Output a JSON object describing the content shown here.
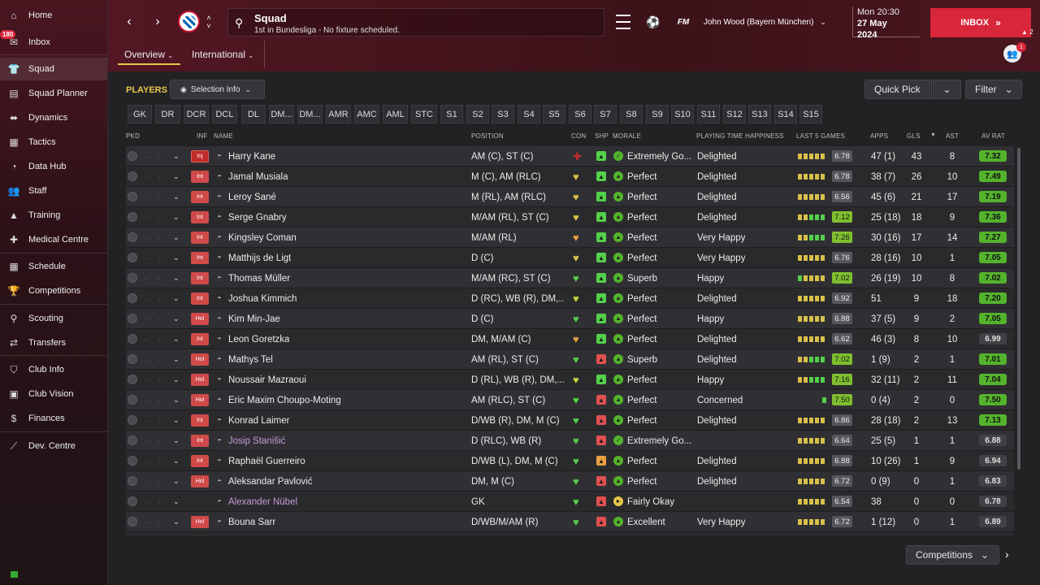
{
  "sidebar": {
    "items": [
      {
        "label": "Home",
        "icon": "home-icon",
        "glyph": "⌂"
      },
      {
        "label": "Inbox",
        "icon": "inbox-icon",
        "glyph": "✉"
      },
      {
        "label": "Squad",
        "icon": "squad-icon",
        "glyph": "👕"
      },
      {
        "label": "Squad Planner",
        "icon": "squad-planner-icon",
        "glyph": "▤"
      },
      {
        "label": "Dynamics",
        "icon": "dynamics-icon",
        "glyph": "⬌"
      },
      {
        "label": "Tactics",
        "icon": "tactics-icon",
        "glyph": "▦"
      },
      {
        "label": "Data Hub",
        "icon": "data-hub-icon",
        "glyph": "◔"
      },
      {
        "label": "Staff",
        "icon": "staff-icon",
        "glyph": "👥"
      },
      {
        "label": "Training",
        "icon": "training-icon",
        "glyph": "▲"
      },
      {
        "label": "Medical Centre",
        "icon": "medical-centre-icon",
        "glyph": "✚"
      },
      {
        "label": "Schedule",
        "icon": "schedule-icon",
        "glyph": "▦"
      },
      {
        "label": "Competitions",
        "icon": "competitions-icon",
        "glyph": "🏆"
      },
      {
        "label": "Scouting",
        "icon": "scouting-icon",
        "glyph": "⚲"
      },
      {
        "label": "Transfers",
        "icon": "transfers-icon",
        "glyph": "⇄"
      },
      {
        "label": "Club Info",
        "icon": "club-info-icon",
        "glyph": "⛉"
      },
      {
        "label": "Club Vision",
        "icon": "club-vision-icon",
        "glyph": "▣"
      },
      {
        "label": "Finances",
        "icon": "finances-icon",
        "glyph": "$"
      },
      {
        "label": "Dev. Centre",
        "icon": "dev-centre-icon",
        "glyph": "⟋"
      }
    ],
    "inbox_badge": "180"
  },
  "header": {
    "title": "Squad",
    "subtitle": "1st in Bundesliga - No fixture scheduled.",
    "manager": "John Wood (Bayern München)",
    "fm": "FM",
    "time": "Mon 20:30",
    "date_line1": "27 May",
    "date_line2": "2024",
    "inbox_label": "INBOX",
    "inbox_count": "2",
    "notif_count": "1"
  },
  "tabs": {
    "overview": "Overview",
    "international": "International"
  },
  "toolbar": {
    "players_label": "PLAYERS",
    "selection_info": "Selection Info",
    "quick_pick": "Quick Pick",
    "filter": "Filter",
    "competitions": "Competitions"
  },
  "positions": [
    "GK",
    "DR",
    "DCR",
    "DCL",
    "DL",
    "DM...",
    "DM...",
    "AMR",
    "AMC",
    "AML",
    "STC",
    "S1",
    "S2",
    "S3",
    "S4",
    "S5",
    "S6",
    "S7",
    "S8",
    "S9",
    "S10",
    "S11",
    "S12",
    "S13",
    "S14",
    "S15"
  ],
  "columns": {
    "pkd": "PKD",
    "inf": "INF",
    "name": "NAME",
    "position": "POSITION",
    "con": "CON",
    "shp": "SHP",
    "morale": "MORALE",
    "pth": "PLAYING TIME HAPPINESS",
    "last5": "LAST 5 GAMES",
    "apps": "APPS",
    "gls": "GLS",
    "ast": "AST",
    "avrat": "AV RAT"
  },
  "colors": {
    "accent": "#d8263a",
    "good": "#54b32c",
    "header": "#521723"
  },
  "players": [
    {
      "inf": "Inj",
      "name": "Harry Kane",
      "position": "AM (C), ST (C)",
      "morale": "Extremely Go...",
      "pth": "Delighted",
      "l5": "6.78",
      "apps": "47 (1)",
      "gls": "43",
      "ast": "8",
      "avrat": "7.32"
    },
    {
      "inf": "Int",
      "name": "Jamal Musiala",
      "position": "M (C), AM (RLC)",
      "morale": "Perfect",
      "pth": "Delighted",
      "l5": "6.78",
      "apps": "38 (7)",
      "gls": "26",
      "ast": "10",
      "avrat": "7.49"
    },
    {
      "inf": "Int",
      "name": "Leroy Sané",
      "position": "M (RL), AM (RLC)",
      "morale": "Perfect",
      "pth": "Delighted",
      "l5": "6.56",
      "apps": "45 (6)",
      "gls": "21",
      "ast": "17",
      "avrat": "7.19"
    },
    {
      "inf": "Int",
      "name": "Serge Gnabry",
      "position": "M/AM (RL), ST (C)",
      "morale": "Perfect",
      "pth": "Delighted",
      "l5": "7.12",
      "apps": "25 (18)",
      "gls": "18",
      "ast": "9",
      "avrat": "7.36"
    },
    {
      "inf": "Int",
      "name": "Kingsley Coman",
      "position": "M/AM (RL)",
      "morale": "Perfect",
      "pth": "Very Happy",
      "l5": "7.26",
      "apps": "30 (16)",
      "gls": "17",
      "ast": "14",
      "avrat": "7.27"
    },
    {
      "inf": "Int",
      "name": "Matthijs de Ligt",
      "position": "D (C)",
      "morale": "Perfect",
      "pth": "Very Happy",
      "l5": "6.76",
      "apps": "28 (16)",
      "gls": "10",
      "ast": "1",
      "avrat": "7.05"
    },
    {
      "inf": "Int",
      "name": "Thomas Müller",
      "position": "M/AM (RC), ST (C)",
      "morale": "Superb",
      "pth": "Happy",
      "l5": "7.02",
      "apps": "26 (19)",
      "gls": "10",
      "ast": "8",
      "avrat": "7.02"
    },
    {
      "inf": "Int",
      "name": "Joshua Kimmich",
      "position": "D (RC), WB (R), DM,...",
      "morale": "Perfect",
      "pth": "Delighted",
      "l5": "6.92",
      "apps": "51",
      "gls": "9",
      "ast": "18",
      "avrat": "7.20"
    },
    {
      "inf": "Hol",
      "name": "Kim Min-Jae",
      "position": "D (C)",
      "morale": "Perfect",
      "pth": "Happy",
      "l5": "6.88",
      "apps": "37 (5)",
      "gls": "9",
      "ast": "2",
      "avrat": "7.05"
    },
    {
      "inf": "Int",
      "name": "Leon Goretzka",
      "position": "DM, M/AM (C)",
      "morale": "Perfect",
      "pth": "Delighted",
      "l5": "6.62",
      "apps": "46 (3)",
      "gls": "8",
      "ast": "10",
      "avrat": "6.99"
    },
    {
      "inf": "Hol",
      "name": "Mathys Tel",
      "position": "AM (RL), ST (C)",
      "morale": "Superb",
      "pth": "Delighted",
      "l5": "7.02",
      "apps": "1 (9)",
      "gls": "2",
      "ast": "1",
      "avrat": "7.01"
    },
    {
      "inf": "Hol",
      "name": "Noussair Mazraoui",
      "position": "D (RL), WB (R), DM,...",
      "morale": "Perfect",
      "pth": "Happy",
      "l5": "7.16",
      "apps": "32 (11)",
      "gls": "2",
      "ast": "11",
      "avrat": "7.04"
    },
    {
      "inf": "Hol",
      "name": "Eric Maxim Choupo-Moting",
      "position": "AM (RLC), ST (C)",
      "morale": "Perfect",
      "pth": "Concerned",
      "l5": "7.50",
      "apps": "0 (4)",
      "gls": "2",
      "ast": "0",
      "avrat": "7.50"
    },
    {
      "inf": "Int",
      "name": "Konrad Laimer",
      "position": "D/WB (R), DM, M (C)",
      "morale": "Perfect",
      "pth": "Delighted",
      "l5": "6.86",
      "apps": "28 (18)",
      "gls": "2",
      "ast": "13",
      "avrat": "7.13"
    },
    {
      "inf": "Int",
      "name": "Josip Stanišić",
      "position": "D (RLC), WB (R)",
      "morale": "Extremely Go...",
      "pth": "",
      "l5": "6.64",
      "apps": "25 (5)",
      "gls": "1",
      "ast": "1",
      "avrat": "6.88"
    },
    {
      "inf": "Int",
      "name": "Raphaël Guerreiro",
      "position": "D/WB (L), DM, M (C)",
      "morale": "Perfect",
      "pth": "Delighted",
      "l5": "6.88",
      "apps": "10 (26)",
      "gls": "1",
      "ast": "9",
      "avrat": "6.94"
    },
    {
      "inf": "Hol",
      "name": "Aleksandar Pavlović",
      "position": "DM, M (C)",
      "morale": "Perfect",
      "pth": "Delighted",
      "l5": "6.72",
      "apps": "0 (9)",
      "gls": "0",
      "ast": "1",
      "avrat": "6.83"
    },
    {
      "inf": "",
      "name": "Alexander Nübel",
      "position": "GK",
      "morale": "Fairly Okay",
      "pth": "",
      "l5": "6.54",
      "apps": "38",
      "gls": "0",
      "ast": "0",
      "avrat": "6.78"
    },
    {
      "inf": "Hol",
      "name": "Bouna Sarr",
      "position": "D/WB/M/AM (R)",
      "morale": "Excellent",
      "pth": "Very Happy",
      "l5": "6.72",
      "apps": "1 (12)",
      "gls": "0",
      "ast": "1",
      "avrat": "6.89"
    }
  ]
}
